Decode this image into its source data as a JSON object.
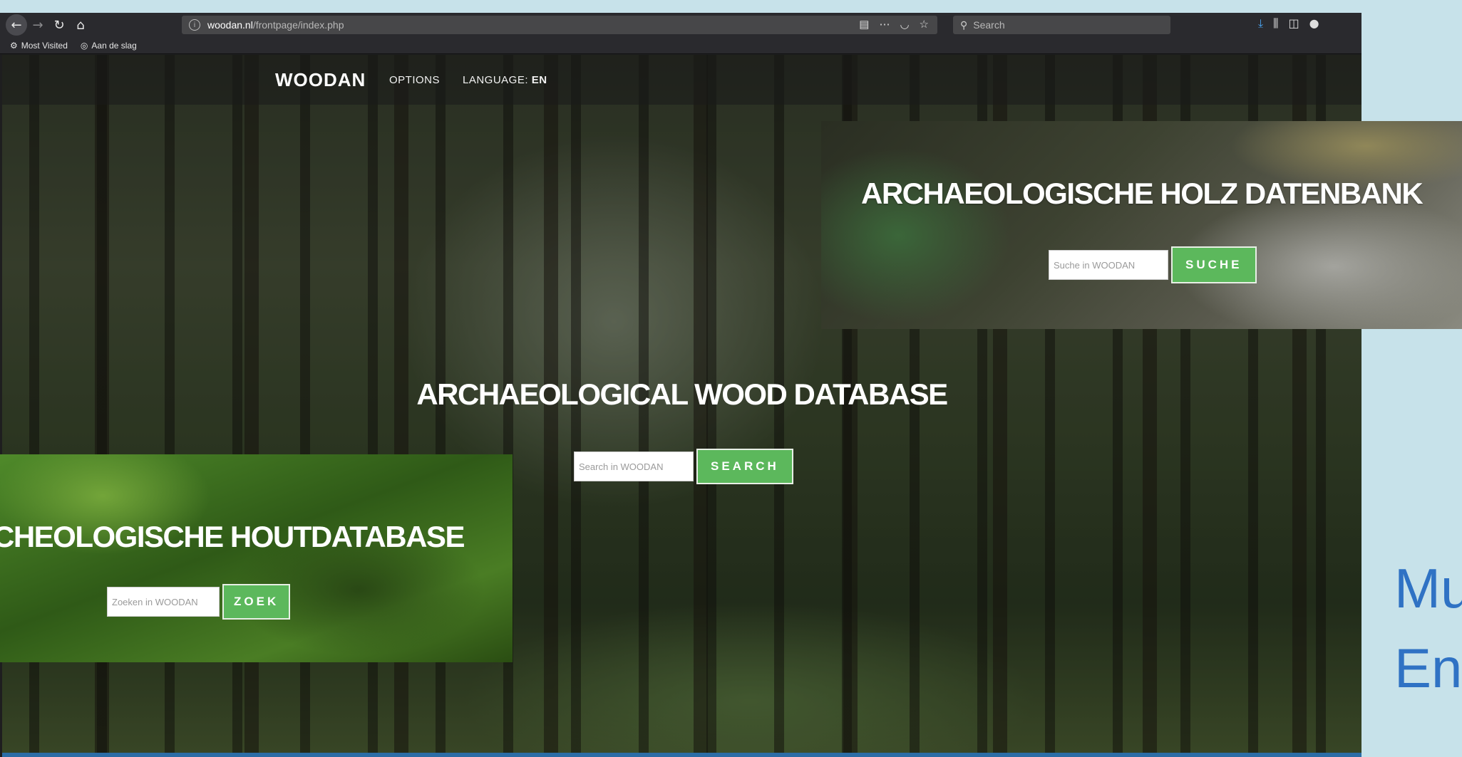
{
  "browser": {
    "url_host": "woodan.nl",
    "url_path": "/frontpage/index.php",
    "search_placeholder": "Search",
    "bookmarks": [
      "Most Visited",
      "Aan de slag"
    ]
  },
  "site": {
    "brand": "WOODAN",
    "nav_options": "OPTIONS",
    "nav_language_label": "LANGUAGE:",
    "nav_language_value": "EN",
    "title": "ARCHAEOLOGICAL WOOD DATABASE",
    "search_placeholder": "Search in WOODAN",
    "search_button": "SEARCH"
  },
  "overlay_de": {
    "title": "ARCHAEOLOGISCHE HOLZ DATENBANK",
    "search_placeholder": "Suche in WOODAN",
    "search_button": "SUCHE"
  },
  "overlay_nl": {
    "title": "CHEOLOGISCHE HOUTDATABASE",
    "search_placeholder": "Zoeken in WOODAN",
    "search_button": "ZOEK"
  },
  "slide": {
    "line1": "Mu",
    "line2": "En"
  },
  "colors": {
    "accent_green": "#5cb85c",
    "slide_text_blue": "#2f72c4",
    "background": "#c7e2ea"
  }
}
